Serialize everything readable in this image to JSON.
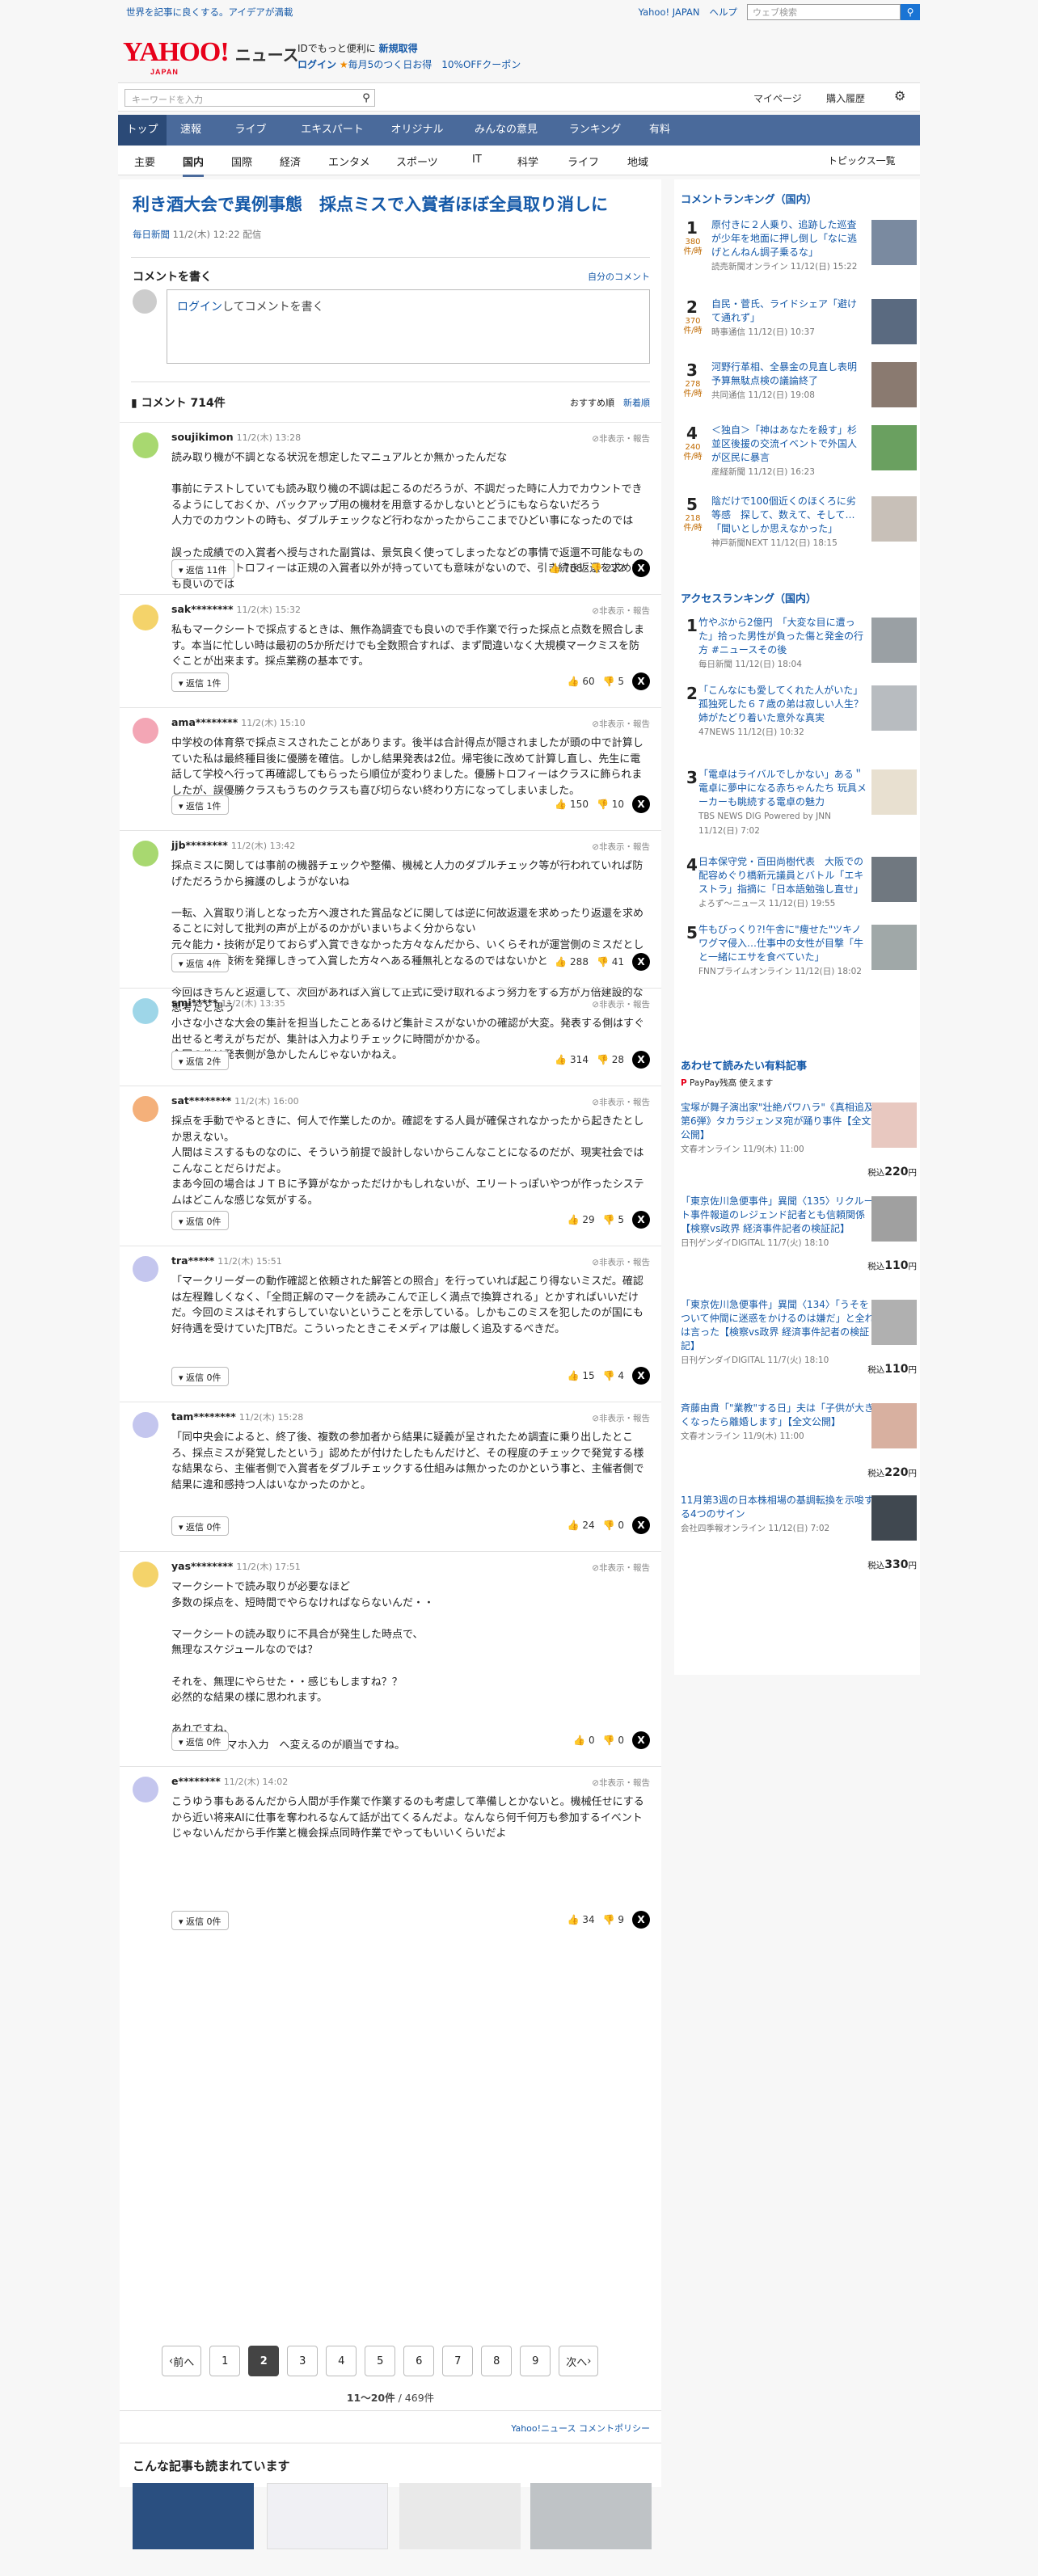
{
  "top": {
    "tagline": "世界を記事に良くする。アイデアが満載",
    "links": [
      "Yahoo! JAPAN",
      "ヘルプ"
    ],
    "search_placeholder": "ウェブ検索"
  },
  "logo": {
    "text": "YAHOO!",
    "sub": "JAPAN",
    "news": "ニュース"
  },
  "promo": {
    "line1a": "IDでもっと便利に",
    "line1b": "新規取得",
    "line2a": "ログイン",
    "line2b": "毎月5のつく日お得",
    "line2c": "10%OFFクーポン"
  },
  "searchbar": {
    "placeholder": "キーワードを入力",
    "mypage": "マイページ",
    "purchase": "購入履歴"
  },
  "nav": [
    "トップ",
    "速報",
    "ライブ",
    "エキスパート",
    "オリジナル",
    "みんなの意見",
    "ランキング",
    "有料"
  ],
  "subnav": [
    "主要",
    "国内",
    "国際",
    "経済",
    "エンタメ",
    "スポーツ",
    "IT",
    "科学",
    "ライフ",
    "地域"
  ],
  "subnav_right": "トピックス一覧",
  "article": {
    "title": "利き酒大会で異例事態　採点ミスで入賞者ほぼ全員取り消しに",
    "source": "毎日新聞",
    "date": "11/2(木) 12:22 配信"
  },
  "comment_form": {
    "heading": "コメントを書く",
    "own": "自分のコメント",
    "login": "ログイン",
    "prompt": "してコメントを書く"
  },
  "comments_header": {
    "count": "コメント 714件",
    "sort1": "おすすめ順",
    "sort2": "新着順"
  },
  "report_label": "非表示・報告",
  "comments": [
    {
      "name": "soujikimon",
      "date": "11/2(木) 13:28",
      "text": "読み取り機が不調となる状況を想定したマニュアルとか無かったんだな\n\n事前にテストしていても読み取り機の不調は起こるのだろうが、不調だった時に人力でカウントできるようにしておくか、バックアップ用の機材を用意するかしないとどうにもならないだろう\n人力でのカウントの時も、ダブルチェックなど行わなかったからここまでひどい事になったのでは\n\n誤った成績での入賞者へ授与された副賞は、景気良く使ってしまったなどの事情で返還不可能なものもあろうが、トロフィーは正規の入賞者以外が持っていても意味がないので、引き続き返還を求めても良いのでは",
      "reply": "返信 11件",
      "up": "768",
      "down": "222"
    },
    {
      "name": "sak********",
      "date": "11/2(木) 15:32",
      "text": "私もマークシートで採点するときは、無作為調査でも良いので手作業で行った採点と点数を照合します。本当に忙しい時は最初の5か所だけでも全数照合すれば、まず間違いなく大規模マークミスを防ぐことが出来ます。採点業務の基本です。",
      "reply": "返信 1件",
      "up": "60",
      "down": "5"
    },
    {
      "name": "ama********",
      "date": "11/2(木) 15:10",
      "text": "中学校の体育祭で採点ミスされたことがあります。後半は合計得点が隠されましたが頭の中で計算していた私は最終種目後に優勝を確信。しかし結果発表は2位。帰宅後に改めて計算し直し、先生に電話して学校へ行って再確認してもらったら順位が変わりました。優勝トロフィーはクラスに飾られましたが、誤優勝クラスもうちのクラスも喜び切らない終わり方になってしまいました。",
      "reply": "返信 1件",
      "up": "150",
      "down": "10"
    },
    {
      "name": "jjb********",
      "date": "11/2(木) 13:42",
      "text": "採点ミスに関しては事前の機器チェックや整備、機械と人力のダブルチェック等が行われていれば防げただろうから擁護のしようがないね\n\n一転、入賞取り消しとなった方へ渡された賞品などに関しては逆に何故返還を求めったり返還を求めることに対して批判の声が上がるのかがいまいちよく分からない\n元々能力・技術が足りておらず入賞できなかった方々なんだから、いくらそれが運営側のミスだとしても能力・技術を発揮しきって入賞した方々へある種無礼となるのではないかと\n\n今回はきちんと返還して、次回があれば入賞して正式に受け取れるよう努力をする方が万倍建設的な思考だと思う",
      "reply": "返信 4件",
      "up": "288",
      "down": "41"
    },
    {
      "name": "smi*****",
      "date": "11/2(木) 13:35",
      "text": "小さな小さな大会の集計を担当したことあるけど集計ミスがないかの確認が大変。発表する側はすぐ出せると考えがちだが、集計は入力よりチェックに時間がかかる。\n今回の件は発表側が急かしたんじゃないかねえ。",
      "reply": "返信 2件",
      "up": "314",
      "down": "28"
    },
    {
      "name": "sat********",
      "date": "11/2(木) 16:00",
      "text": "採点を手動でやるときに、何人で作業したのか。確認をする人員が確保されなかったから起きたとしか思えない。\n人間はミスするものなのに、そういう前提で設計しないからこんなことになるのだが、現実社会ではこんなことだらけだよ。\nまあ今回の場合はＪＴＢに予算がなかっただけかもしれないが、エリートっぽいやつが作ったシステムはどこんな感じな気がする。",
      "reply": "返信 0件",
      "up": "29",
      "down": "5"
    },
    {
      "name": "tra*****",
      "date": "11/2(木) 15:51",
      "text": "「マークリーダーの動作確認と依頼された解答との照合」を行っていれば起こり得ないミスだ。確認は左程難しくなく、「全問正解のマークを読みこんで正しく満点で換算される」とかすればいいだけだ。今回のミスはそれすらしていないということを示している。しかもこのミスを犯したのが国にも好待遇を受けていたJTBだ。こういったときこそメディアは厳しく追及するべきだ。",
      "reply": "返信 0件",
      "up": "15",
      "down": "4"
    },
    {
      "name": "tam********",
      "date": "11/2(木) 15:28",
      "text": "「同中央会によると、終了後、複数の参加者から結果に疑義が呈されたため調査に乗り出したところ、採点ミスが発覚したという」認めたが付けたしたもんだけど、その程度のチェックで発覚する様な結果なら、主催者側で入賞者をダブルチェックする仕組みは無かったのかという事と、主催者側で結果に違和感持つ人はいなかったのかと。",
      "reply": "返信 0件",
      "up": "24",
      "down": "0"
    },
    {
      "name": "yas********",
      "date": "11/2(木) 17:51",
      "text": "マークシートで読み取りが必要なほど\n多数の採点を、短時間でやらなければならないんだ・・\n\nマークシートの読み取りに不具合が発生した時点で、\n無理なスケジュールなのでは？\n\nそれを、無理にやらせた・・感じもしますね？？\n必然的な結果の様に思われます。\n\nあれですね、\nPC入力、スマホ入力　へ変えるのが順当ですね。",
      "reply": "返信 0件",
      "up": "0",
      "down": "0"
    },
    {
      "name": "e********",
      "date": "11/2(木) 14:02",
      "text": "こうゆう事もあるんだから人間が手作業で作業するのも考慮して準備しとかないと。機械任せにするから近い将来AIに仕事を奪われるなんて話が出てくるんだよ。なんなら何千何万も参加するイベントじゃないんだから手作業と機会採点同時作業でやってもいいくらいだよ",
      "reply": "返信 0件",
      "up": "34",
      "down": "9"
    }
  ],
  "pager": {
    "prev": "前へ",
    "next": "次へ",
    "pages": [
      "1",
      "2",
      "3",
      "4",
      "5",
      "6",
      "7",
      "8",
      "9"
    ],
    "current": "2",
    "info": "11〜20件",
    "total": "/ 469件"
  },
  "policy": "Yahoo!ニュース コメントポリシー",
  "also_read": "こんな記事も読まれています",
  "ranking": {
    "title": "コメントランキング（国内）",
    "unit": "件/時",
    "items": [
      {
        "n": "1",
        "count": "380",
        "title": "原付きに２人乗り、追跡した巡査が少年を地面に押し倒し「なに逃げとんねん調子乗るな」",
        "src": "読売新聞オンライン 11/12(日) 15:22"
      },
      {
        "n": "2",
        "count": "370",
        "title": "自民・菅氏、ライドシェア「避けて通れず」",
        "src": "時事通信 11/12(日) 10:37"
      },
      {
        "n": "3",
        "count": "278",
        "title": "河野行革相、全暴金の見直し表明　予算無駄点検の議論終了",
        "src": "共同通信 11/12(日) 19:08"
      },
      {
        "n": "4",
        "count": "240",
        "title": "＜独自＞「神はあなたを殺す」杉並区後援の交流イベントで外国人が区民に暴言",
        "src": "産経新聞 11/12(日) 16:23"
      },
      {
        "n": "5",
        "count": "218",
        "title": "陰だけで100個近くのほくろに劣等感　探して、数えて、そして…「聞いとしか思えなかった」",
        "src": "神戸新聞NEXT 11/12(日) 18:15"
      }
    ]
  },
  "access": {
    "title": "アクセスランキング（国内）",
    "items": [
      {
        "n": "1",
        "title": "竹やぶから2億円　「大変な目に遭った」拾った男性が負った傷と発金の行方 #ニュースその後",
        "src": "毎日新聞 11/12(日) 18:04"
      },
      {
        "n": "2",
        "title": "「こんなにも愛してくれた人がいた」孤独死した６７歳の弟は寂しい人生？　姉がたどり着いた意外な真実",
        "src": "47NEWS 11/12(日) 10:32"
      },
      {
        "n": "3",
        "title": "「電卓はライバルでしかない」ある＂電卓に夢中になる赤ちゃんたち 玩具メーカーも眺続する電卓の魅力",
        "src": "TBS NEWS DIG Powered by JNN 11/12(日) 7:02"
      },
      {
        "n": "4",
        "title": "日本保守党・百田尚樹代表　大阪での配容めぐり橋新元議員とバトル「エキストラ」指摘に「日本語勉強し直せ」",
        "src": "よろず〜ニュース 11/12(日) 19:55"
      },
      {
        "n": "5",
        "title": "牛もびっくり?!午舎に\"痩せた\"ツキノワグマ侵入…仕事中の女性が目撃「牛と一緒にエサを食べていた」",
        "src": "FNNプライムオンライン 11/12(日) 18:02"
      }
    ]
  },
  "paid": {
    "title": "あわせて読みたい有料記事",
    "paypay": "PayPay残高 使えます",
    "items": [
      {
        "title": "宝塚が舞子演出家\"壮絶パワハラ\"《真相追及第6弾》タカラジェンヌ宛が踊り事件【全文公開】",
        "src": "文春オンライン 11/9(木) 11:00",
        "price": "220",
        "pre": "税込",
        "suf": "円"
      },
      {
        "title": "「東京佐川急便事件」異聞〈135〉リクルート事件報道のレジェンド記者とも信頼関係【検察vs政界 経済事件記者の検証記】",
        "src": "日刊ゲンダイDIGITAL 11/7(火) 18:10",
        "price": "110",
        "pre": "税込",
        "suf": "円"
      },
      {
        "title": "「東京佐川急便事件」異聞〈134〉「うそをついて仲間に迷惑をかけるのは嫌だ」と全れは言った【検察vs政界 経済事件記者の検証記】",
        "src": "日刊ゲンダイDIGITAL 11/7(火) 18:10",
        "price": "110",
        "pre": "税込",
        "suf": "円"
      },
      {
        "title": "斉藤由貴「\"業教\"する日」夫は「子供が大きくなったら離婚します」【全文公開】",
        "src": "文春オンライン 11/9(木) 11:00",
        "price": "220",
        "pre": "税込",
        "suf": "円"
      },
      {
        "title": "11月第3週の日本株相場の基調転換を示唆する4つのサイン",
        "src": "会社四季報オンライン 11/12(日) 7:02",
        "price": "330",
        "pre": "税込",
        "suf": "円"
      }
    ]
  },
  "colors": {
    "link": "#1559a8",
    "nav": "#4a6a9b",
    "brand": "#e7001a"
  }
}
